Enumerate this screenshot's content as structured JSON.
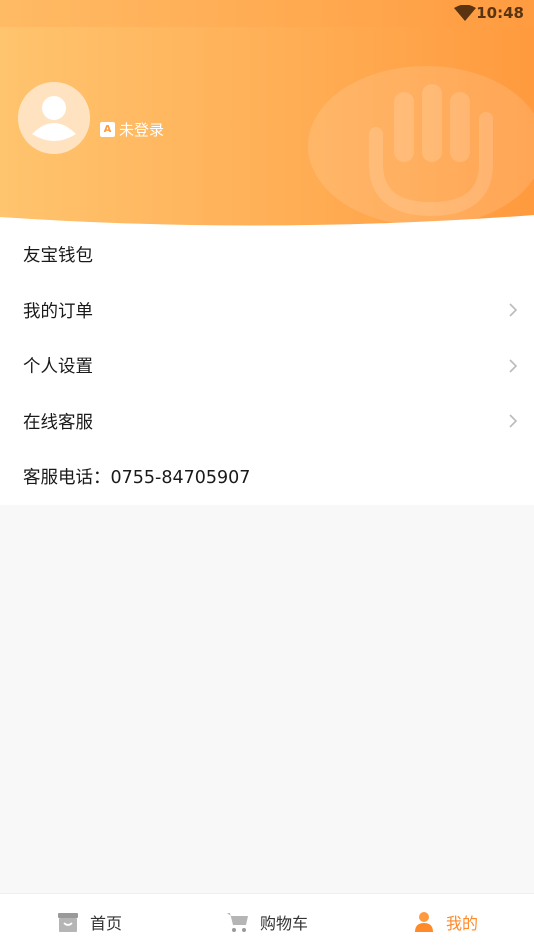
{
  "status_bar": {
    "time": "10:48",
    "wifi_icon": "wifi-icon"
  },
  "profile": {
    "avatar_icon": "avatar-placeholder-icon",
    "login_icon": "login-badge-icon",
    "login_badge_glyph": "A",
    "login_text": "未登录"
  },
  "menu": {
    "items": [
      {
        "label": "友宝钱包",
        "has_chevron": false
      },
      {
        "label": "我的订单",
        "has_chevron": true
      },
      {
        "label": "个人设置",
        "has_chevron": true
      },
      {
        "label": "在线客服",
        "has_chevron": true
      },
      {
        "label": "客服电话：0755-84705907",
        "has_chevron": false
      }
    ]
  },
  "bottom_nav": {
    "tabs": [
      {
        "label": "首页",
        "icon": "home-icon",
        "active": false
      },
      {
        "label": "购物车",
        "icon": "cart-icon",
        "active": false
      },
      {
        "label": "我的",
        "icon": "person-icon",
        "active": true
      }
    ]
  },
  "colors": {
    "accent": "#ff8a2a",
    "header_start": "#ffc46e",
    "header_end": "#ff9a3e"
  }
}
